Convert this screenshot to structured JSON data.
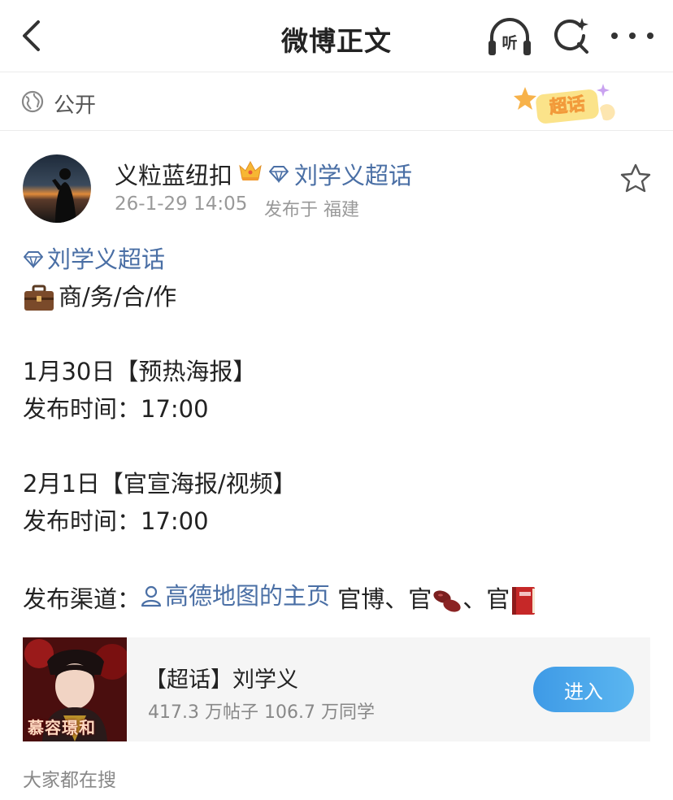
{
  "navbar": {
    "title": "微博正文",
    "listen_label": "听"
  },
  "visibility": {
    "label": "公开",
    "badge_text": "超话"
  },
  "author": {
    "name": "义粒蓝纽扣",
    "topic": "刘学义超话",
    "time": "26-1-29 14:05",
    "location": "发布于 福建"
  },
  "post": {
    "topic_link": "刘学义超话",
    "business": "商/务/合/作",
    "date1": "1月30日【预热海报】",
    "time_label1": "发布时间：17:00",
    "date2": "2月1日【官宣海报/视频】",
    "time_label2": "发布时间：17:00",
    "channel_prefix": "发布渠道：",
    "channel_user": "高德地图的主页",
    "channel_suffix1": " 官博、官",
    "channel_suffix2": "、官"
  },
  "card": {
    "image_caption": "慕容璟和",
    "title": "【超话】刘学义",
    "stats": "417.3 万帖子 106.7 万同学",
    "enter_label": "进入"
  },
  "search_hint": "大家都在搜",
  "colors": {
    "link": "#4a6fa5",
    "enter_button": "#4aa8ec",
    "divider": "#ebebeb"
  }
}
